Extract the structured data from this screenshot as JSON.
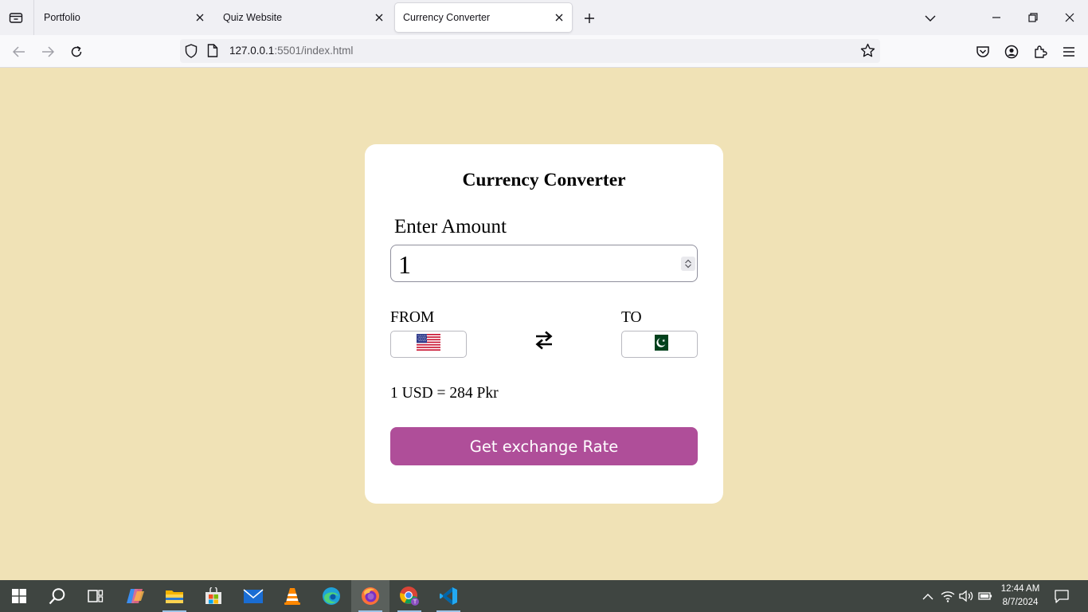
{
  "browser": {
    "tabs": [
      {
        "title": "Portfolio",
        "active": false
      },
      {
        "title": "Quiz Website",
        "active": false
      },
      {
        "title": "Currency Converter",
        "active": true
      }
    ],
    "url": {
      "host": "127.0.0.1",
      "rest": ":5501/index.html"
    }
  },
  "app": {
    "title": "Currency Converter",
    "amount_label": "Enter Amount",
    "amount_value": "1",
    "from_label": "FROM",
    "from_currency_flag": "us-flag-icon",
    "to_label": "TO",
    "to_currency_flag": "pk-flag-icon",
    "rate_text": "1 USD = 284 Pkr",
    "button_label": "Get exchange Rate",
    "colors": {
      "background": "#f0e2b6",
      "card": "#ffffff",
      "button": "#af4e99"
    }
  },
  "taskbar": {
    "apps": [
      "windows-start",
      "search",
      "task-view",
      "copilot",
      "file-explorer",
      "microsoft-store",
      "mail",
      "vlc",
      "edge",
      "firefox",
      "chrome",
      "vscode"
    ],
    "time": "12:44 AM",
    "date": "8/7/2024"
  }
}
